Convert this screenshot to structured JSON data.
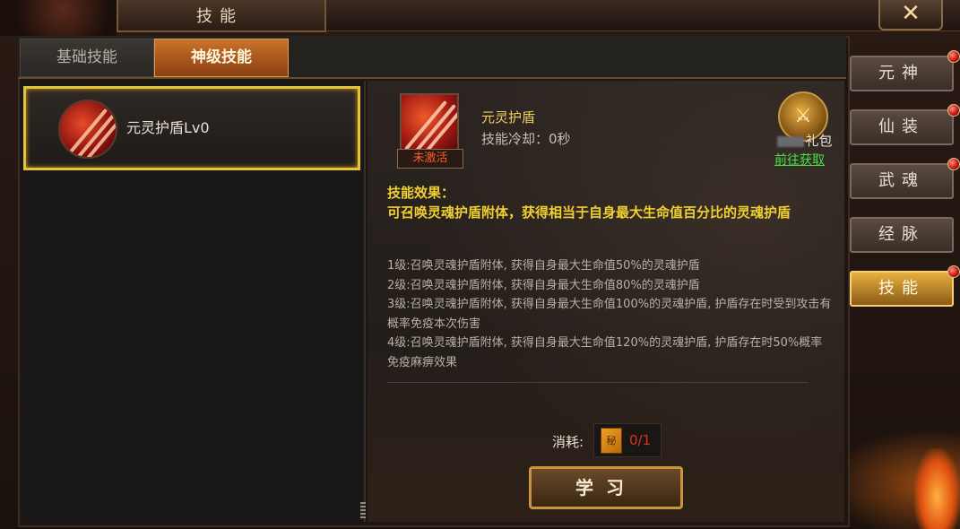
{
  "window": {
    "title": "技能",
    "close_symbol": "✕"
  },
  "tabs": [
    {
      "label": "基础技能",
      "active": false
    },
    {
      "label": "神级技能",
      "active": true
    }
  ],
  "skill_list": [
    {
      "label": "元灵护盾Lv0",
      "selected": true
    }
  ],
  "detail": {
    "name": "元灵护盾",
    "cooldown": "技能冷却：0秒",
    "status_badge": "未激活",
    "gift_label": "礼包",
    "goto_link": "前往获取",
    "effect_heading": "技能效果：",
    "effect_description": "可召唤灵魂护盾附体，获得相当于自身最大生命值百分比的灵魂护盾",
    "levels": [
      "1级:召唤灵魂护盾附体, 获得自身最大生命值50%的灵魂护盾",
      "2级:召唤灵魂护盾附体, 获得自身最大生命值80%的灵魂护盾",
      "3级:召唤灵魂护盾附体, 获得自身最大生命值100%的灵魂护盾, 护盾存在时受到攻击有概率免疫本次伤害",
      "4级:召唤灵魂护盾附体, 获得自身最大生命值120%的灵魂护盾, 护盾存在时50%概率免疫麻痹效果"
    ],
    "cost_label": "消耗:",
    "cost_count": "0/1",
    "learn_button": "学习"
  },
  "side_nav": [
    {
      "label": "元神",
      "active": false,
      "has_dot": true
    },
    {
      "label": "仙装",
      "active": false,
      "has_dot": true
    },
    {
      "label": "武魂",
      "active": false,
      "has_dot": true
    },
    {
      "label": "经脉",
      "active": false,
      "has_dot": false
    },
    {
      "label": "技能",
      "active": true,
      "has_dot": true
    }
  ],
  "icons": {
    "skill_icon": "shield-slash-icon",
    "gift_icon": "gift-bag-icon",
    "book_icon": "skill-book-icon",
    "close_icon": "close-icon"
  },
  "colors": {
    "accent_gold": "#f0d030",
    "link_green": "#4ae04a",
    "warn_red": "#e03020",
    "selected_border": "#e6c23a"
  }
}
